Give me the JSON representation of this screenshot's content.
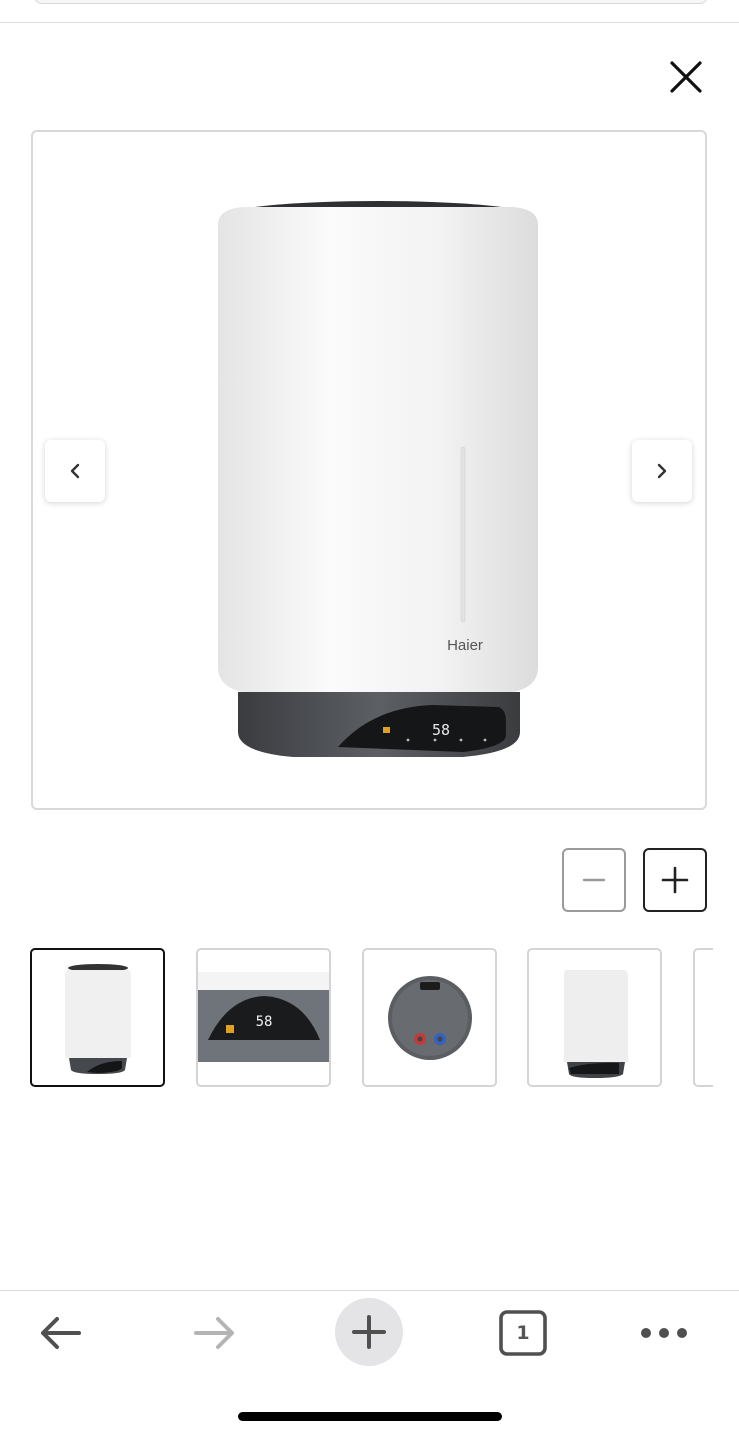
{
  "viewer": {
    "close_icon": "close-icon",
    "prev_icon": "chevron-left-icon",
    "next_icon": "chevron-right-icon",
    "zoom_out_icon": "minus-icon",
    "zoom_in_icon": "plus-icon",
    "main_image": {
      "brand_text": "Haier",
      "display_reading": "58"
    },
    "thumbnails": [
      {
        "content": "water-heater-front",
        "selected": true
      },
      {
        "content": "control-panel-closeup",
        "display_reading": "58"
      },
      {
        "content": "water-heater-bottom-view"
      },
      {
        "content": "water-heater-side"
      },
      {
        "content": "more-thumbnail-partial"
      }
    ]
  },
  "browser_toolbar": {
    "back_icon": "arrow-left-icon",
    "forward_icon": "arrow-right-icon",
    "new_tab_icon": "plus-icon",
    "tabs_count": "1",
    "more_icon": "more-dots-icon"
  },
  "colors": {
    "border_selected": "#111111",
    "border_default": "#d4d4d4",
    "heater_body": "#f3f3f3",
    "heater_base": "#4a4d52",
    "new_tab_bg": "#e4e4e6"
  }
}
